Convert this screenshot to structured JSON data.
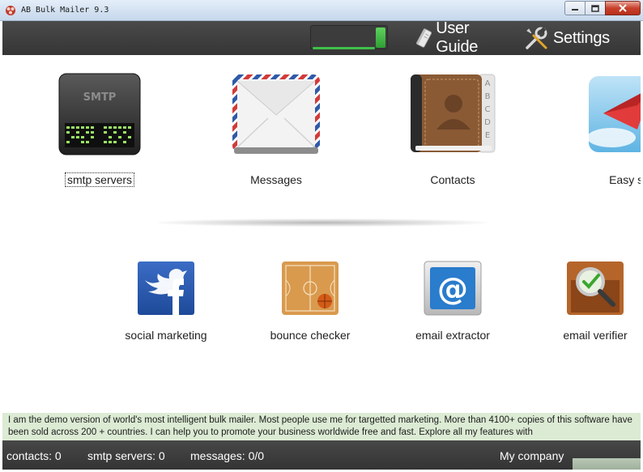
{
  "window": {
    "title": "AB Bulk Mailer 9.3"
  },
  "toolbar": {
    "progress_level": 0.85,
    "user_guide_label": "User Guide",
    "settings_label": "Settings"
  },
  "modules_top": [
    {
      "label": "smtp servers",
      "icon": "smtp-device-icon"
    },
    {
      "label": "Messages",
      "icon": "envelope-icon"
    },
    {
      "label": "Contacts",
      "icon": "address-book-icon"
    },
    {
      "label": "Easy se",
      "icon": "paper-plane-icon"
    }
  ],
  "modules_bottom": [
    {
      "label": "social marketing",
      "icon": "social-media-icon"
    },
    {
      "label": "bounce checker",
      "icon": "basketball-court-icon"
    },
    {
      "label": "email extractor",
      "icon": "at-sign-icon"
    },
    {
      "label": "email verifier",
      "icon": "magnifier-check-icon"
    }
  ],
  "marquee": {
    "text": "I am the demo version of world's most intelligent bulk mailer. Most people use me for targetted marketing. More than 4100+ copies of this software have been sold across 200 + countries. I can help you to promote your business worldwide free and fast. Explore all my features with"
  },
  "status": {
    "contacts": "contacts: 0",
    "smtp_servers": "smtp servers: 0",
    "messages": "messages: 0/0",
    "company": "My company"
  },
  "colors": {
    "toolbar_bg": "#3e3e3e",
    "accent_green": "#3fbf4a",
    "marquee_bg": "#dcebd4"
  }
}
